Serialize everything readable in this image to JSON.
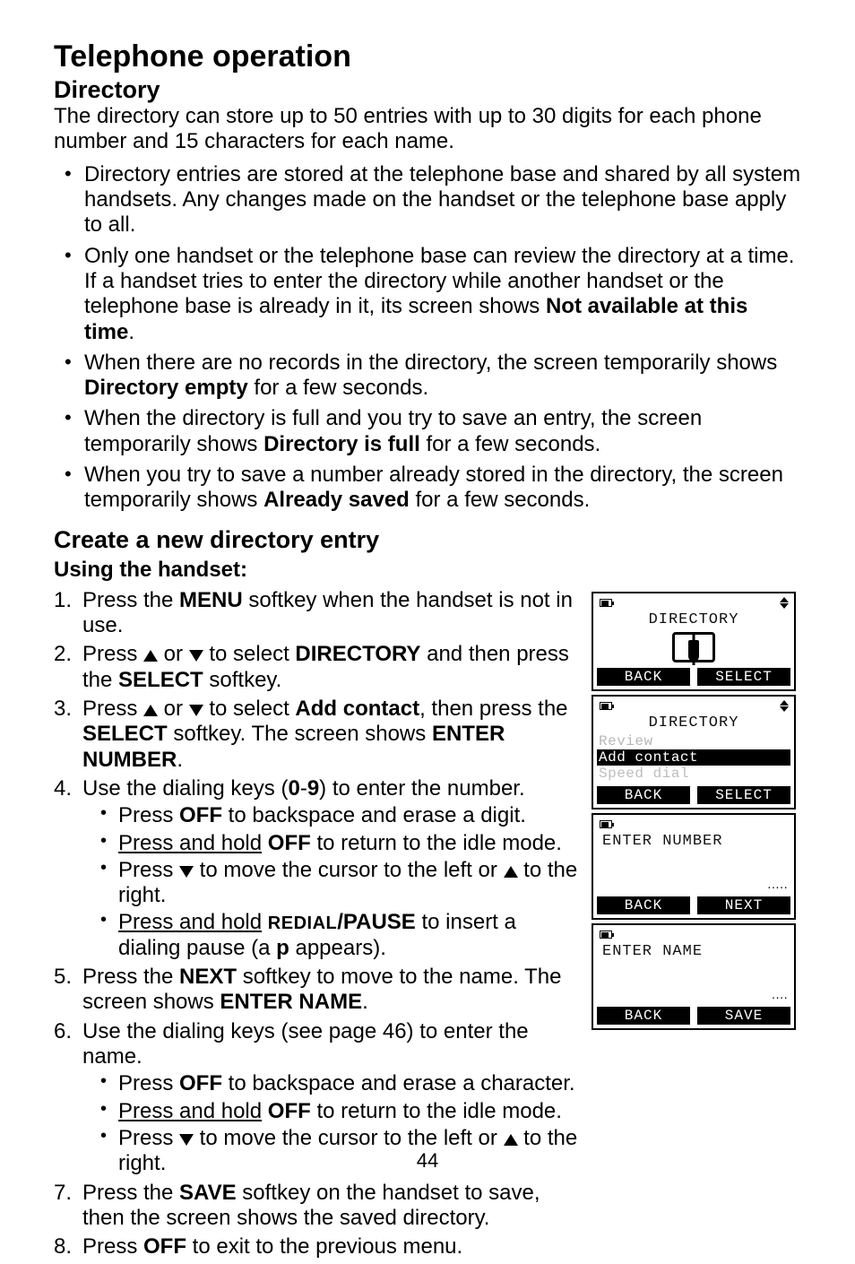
{
  "page_title": "Telephone operation",
  "section": "Directory",
  "intro": "The directory can store up to 50 entries with up to 30 digits for each phone number and 15 characters for each name.",
  "bullets": [
    {
      "text": "Directory entries are stored at the telephone base and shared by all system handsets. Any changes made on the handset or the telephone base apply to all."
    },
    {
      "pre": "Only one handset or the telephone base can review the directory at a time. If a handset tries to enter the directory while another handset or the telephone base is already in it, its screen shows ",
      "bold": "Not available at this time",
      "post": "."
    },
    {
      "pre": "When there are no records in the directory, the screen temporarily shows ",
      "bold": "Directory empty",
      "post": " for a few seconds."
    },
    {
      "pre": "When the directory is full and you try to save an entry, the screen temporarily shows ",
      "bold": "Directory is full",
      "post": " for a few seconds."
    },
    {
      "pre": "When you try to save a number already stored in the directory, the screen temporarily shows ",
      "bold": "Already saved",
      "post": " for a few seconds."
    }
  ],
  "subsection": "Create a new directory entry",
  "sub_using": "Using the handset:",
  "steps": {
    "s1": {
      "pre": "Press the ",
      "b1": "MENU",
      "post": " softkey when the handset is not in use."
    },
    "s2": {
      "a": "Press ",
      "b": " or ",
      "c": " to select ",
      "d": "DIRECTORY",
      "e": " and then press the ",
      "f": "SELECT",
      "g": " softkey."
    },
    "s3": {
      "a": "Press ",
      "b": " or ",
      "c": " to select ",
      "d": "Add contact",
      "e": ", then press the ",
      "f": "SELECT",
      "g": " softkey. The screen shows ",
      "h": "ENTER NUMBER",
      "i": "."
    },
    "s4": {
      "a": "Use the dialing keys (",
      "b": "0",
      "dash": "-",
      "c": "9",
      "d": ") to enter the number."
    },
    "s4sub": {
      "a": {
        "p1": "Press ",
        "b": "OFF",
        "p2": " to backspace and erase a digit."
      },
      "b": {
        "u": "Press and hold",
        "sp": " ",
        "b": "OFF",
        "p2": " to return to the idle mode."
      },
      "c": {
        "p1": "Press ",
        "p2": " to move the cursor to the left or ",
        "p3": " to the right."
      },
      "d": {
        "u": "Press and hold",
        "sp": " ",
        "sc": "REDIAL",
        "b": "/PAUSE",
        "p2": "  to insert a dialing pause (a ",
        "pb": "p",
        "p3": " appears)."
      }
    },
    "s5": {
      "a": "Press the ",
      "b": "NEXT",
      "c": " softkey to move to the name. The screen shows ",
      "d": "ENTER NAME",
      "e": "."
    },
    "s6": {
      "a": "Use the dialing keys (see page 46) to enter the name."
    },
    "s6sub": {
      "a": {
        "p1": "Press ",
        "b": "OFF",
        "p2": " to backspace and erase a character."
      },
      "b": {
        "u": "Press and hold",
        "sp": " ",
        "b": "OFF",
        "p2": " to return to the idle mode."
      },
      "c": {
        "p1": "Press ",
        "p2": " to move the cursor to the left or ",
        "p3": " to the right."
      }
    },
    "s7": {
      "a": "Press the ",
      "b": "SAVE",
      "c": " softkey on the handset to save, then the screen shows the saved directory."
    },
    "s8": {
      "a": "Press ",
      "b": "OFF",
      "c": " to exit to the previous menu."
    }
  },
  "screens": {
    "s1": {
      "title": "DIRECTORY",
      "back": "BACK",
      "select": "SELECT"
    },
    "s2": {
      "title": "DIRECTORY",
      "row1": "Review",
      "row2": "Add contact",
      "row3": "Speed dial",
      "back": "BACK",
      "select": "SELECT"
    },
    "s3": {
      "title": "ENTER NUMBER",
      "back": "BACK",
      "next": "NEXT"
    },
    "s4": {
      "title": "ENTER NAME",
      "back": "BACK",
      "save": "SAVE"
    }
  },
  "page_number": "44"
}
